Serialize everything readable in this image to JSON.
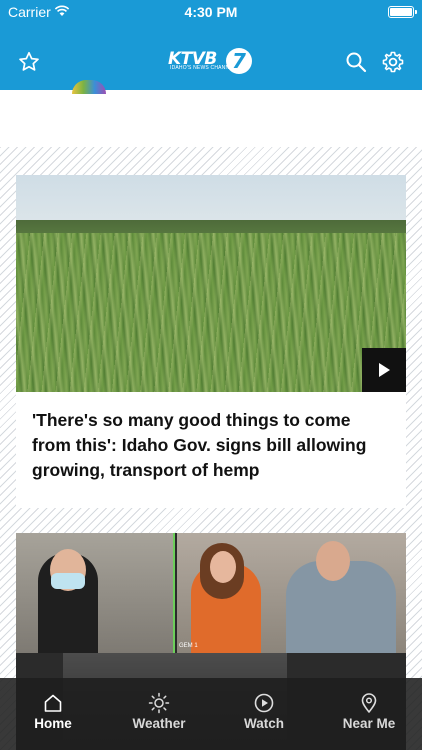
{
  "status_bar": {
    "carrier": "Carrier",
    "time": "4:30 PM"
  },
  "header": {
    "logo_text": "KTVB",
    "logo_number": "7",
    "logo_tagline": "IDAHO'S NEWS CHANNEL",
    "background_color": "#1a9ad6",
    "icons": [
      "star-icon",
      "search-icon",
      "gear-icon"
    ]
  },
  "feed": {
    "stories": [
      {
        "headline": "'There's so many good things to come from this': Idaho Gov. signs bill allowing growing, transport of hemp",
        "has_video": true
      },
      {
        "overlay_label": "GEM 1"
      }
    ]
  },
  "tab_bar": {
    "tabs": [
      {
        "label": "Home",
        "icon": "home-icon",
        "active": true
      },
      {
        "label": "Weather",
        "icon": "sun-icon",
        "active": false
      },
      {
        "label": "Watch",
        "icon": "play-circle-icon",
        "active": false
      },
      {
        "label": "Near Me",
        "icon": "location-pin-icon",
        "active": false
      }
    ]
  }
}
